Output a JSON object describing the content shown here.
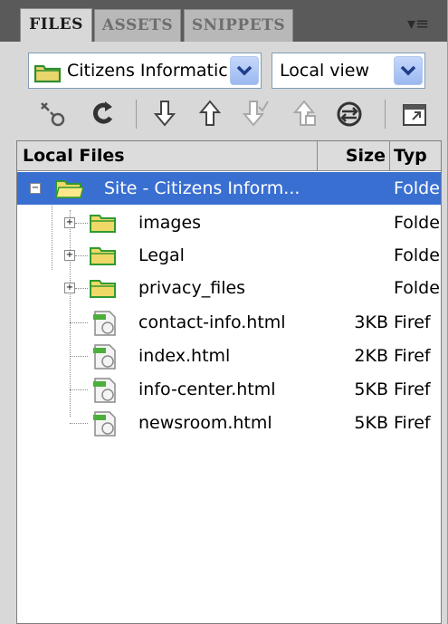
{
  "tabs": [
    {
      "label": "FILES",
      "active": true
    },
    {
      "label": "ASSETS",
      "active": false
    },
    {
      "label": "SNIPPETS",
      "active": false
    }
  ],
  "menu_glyph": "▾≡",
  "site_select": {
    "value": "Citizens Informatic"
  },
  "view_select": {
    "value": "Local view"
  },
  "toolbar": {
    "buttons": [
      "connect-icon",
      "refresh-icon",
      "get-icon",
      "put-icon",
      "check-out-icon",
      "check-in-icon",
      "synchronize-icon",
      "expand-icon"
    ]
  },
  "columns": {
    "name": "Local Files",
    "size": "Size",
    "type": "Typ"
  },
  "rows": [
    {
      "name": "Site - Citizens Inform...",
      "size": "",
      "type": "Folde",
      "kind": "site",
      "selected": true
    },
    {
      "name": "images",
      "size": "",
      "type": "Folde",
      "kind": "folder",
      "selected": false
    },
    {
      "name": "Legal",
      "size": "",
      "type": "Folde",
      "kind": "folder",
      "selected": false
    },
    {
      "name": "privacy_files",
      "size": "",
      "type": "Folde",
      "kind": "folder",
      "selected": false
    },
    {
      "name": "contact-info.html",
      "size": "3KB",
      "type": "Firef",
      "kind": "file",
      "selected": false
    },
    {
      "name": "index.html",
      "size": "2KB",
      "type": "Firef",
      "kind": "file",
      "selected": false
    },
    {
      "name": "info-center.html",
      "size": "5KB",
      "type": "Firef",
      "kind": "file",
      "selected": false
    },
    {
      "name": "newsroom.html",
      "size": "5KB",
      "type": "Firef",
      "kind": "file",
      "selected": false
    }
  ],
  "colors": {
    "selection": "#3a6fd2",
    "folder": "#f0d868",
    "folder_green": "#2f9a2f"
  }
}
